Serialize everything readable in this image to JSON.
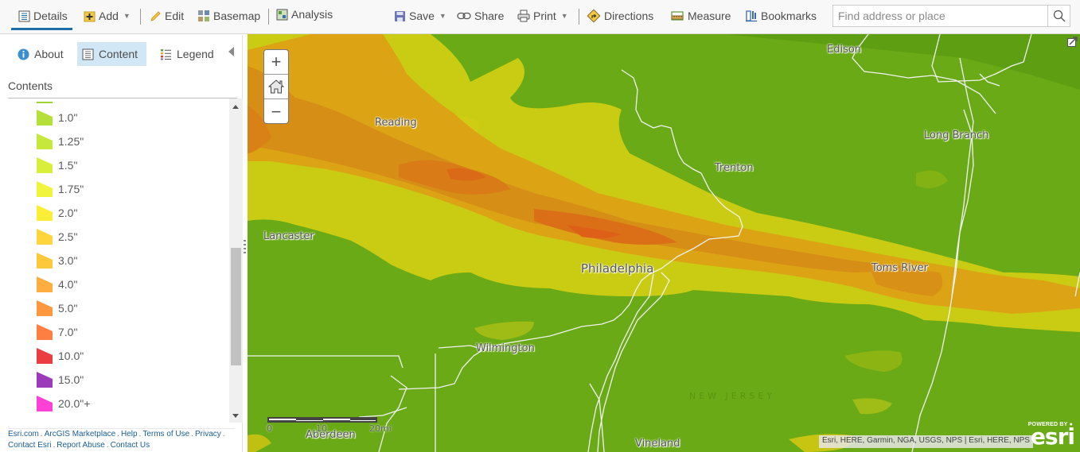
{
  "toolbar": {
    "details": "Details",
    "add": "Add",
    "edit": "Edit",
    "basemap": "Basemap",
    "analysis": "Analysis",
    "save": "Save",
    "share": "Share",
    "print": "Print",
    "directions": "Directions",
    "measure": "Measure",
    "bookmarks": "Bookmarks",
    "search_placeholder": "Find address or place",
    "search_value": ""
  },
  "sidebar": {
    "tabs": [
      {
        "label": "About",
        "icon": "info-icon",
        "active": false
      },
      {
        "label": "Content",
        "icon": "content-list-icon",
        "active": true
      },
      {
        "label": "Legend",
        "icon": "legend-icon",
        "active": false
      }
    ],
    "section_title": "Contents",
    "legend": [
      {
        "label": "1.0\"",
        "color": "#b5e03a"
      },
      {
        "label": "1.25\"",
        "color": "#c6e83a"
      },
      {
        "label": "1.5\"",
        "color": "#d9ee3a"
      },
      {
        "label": "1.75\"",
        "color": "#f1f43d"
      },
      {
        "label": "2.0\"",
        "color": "#fced36"
      },
      {
        "label": "2.5\"",
        "color": "#fed53c"
      },
      {
        "label": "3.0\"",
        "color": "#fec83d"
      },
      {
        "label": "4.0\"",
        "color": "#feae3e"
      },
      {
        "label": "5.0\"",
        "color": "#fe9840"
      },
      {
        "label": "7.0\"",
        "color": "#fe7f3f"
      },
      {
        "label": "10.0\"",
        "color": "#ea3e40"
      },
      {
        "label": "15.0\"",
        "color": "#9c3bb9"
      },
      {
        "label": "20.0\"+",
        "color": "#fd41d6"
      }
    ],
    "footer_links": [
      "Esri.com",
      "ArcGIS Marketplace",
      "Help",
      "Terms of Use",
      "Privacy",
      "Contact Esri",
      "Report Abuse",
      "Contact Us"
    ]
  },
  "map": {
    "cities": [
      {
        "name": "Edison",
        "key": "edison"
      },
      {
        "name": "Reading",
        "key": "reading"
      },
      {
        "name": "Trenton",
        "key": "trenton"
      },
      {
        "name": "Long Branch",
        "key": "long-branch"
      },
      {
        "name": "Lancaster",
        "key": "lancaster"
      },
      {
        "name": "Philadelphia",
        "key": "philadelphia"
      },
      {
        "name": "Toms River",
        "key": "toms-river"
      },
      {
        "name": "Wilmington",
        "key": "wilmington"
      },
      {
        "name": "Aberdeen",
        "key": "aberdeen"
      },
      {
        "name": "Vineland",
        "key": "vineland"
      }
    ],
    "state_label": "NEW JERSEY",
    "zoom_in": "+",
    "zoom_out": "−",
    "scale": {
      "labels": [
        "0",
        "10",
        "20mi"
      ]
    },
    "attribution": "Esri, HERE, Garmin, NGA, USGS, NPS | Esri, HERE, NPS",
    "logo_powered": "POWERED BY",
    "logo_word": "esri"
  }
}
